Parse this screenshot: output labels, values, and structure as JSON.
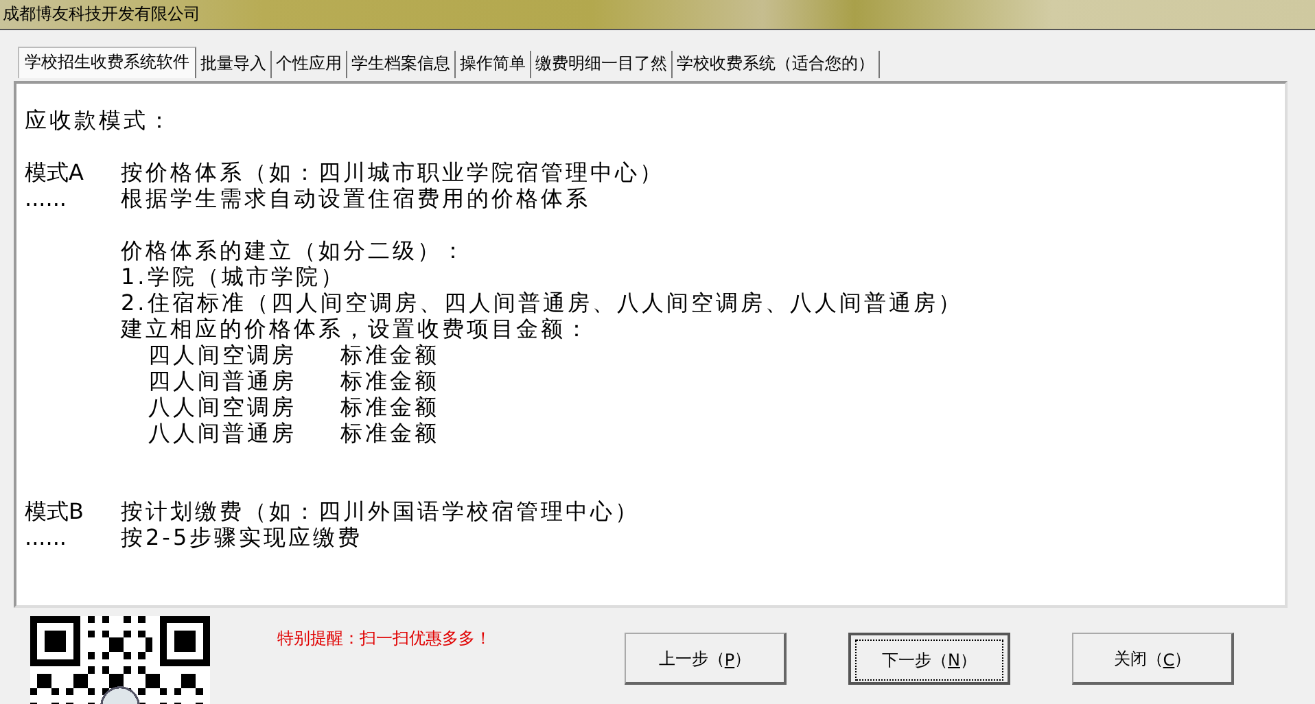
{
  "window": {
    "title": "成都博友科技开发有限公司"
  },
  "tabs": [
    {
      "label": "学校招生收费系统软件",
      "selected": true
    },
    {
      "label": "批量导入",
      "selected": false
    },
    {
      "label": "个性应用",
      "selected": false
    },
    {
      "label": "学生档案信息",
      "selected": false
    },
    {
      "label": "操作简单",
      "selected": false
    },
    {
      "label": "缴费明细一目了然",
      "selected": false
    },
    {
      "label": "学校收费系统（适合您的）",
      "selected": false
    }
  ],
  "content": {
    "sections": [
      {
        "lines": [
          {
            "kind": "plain",
            "text": "应收款模式："
          }
        ]
      },
      {
        "lines": [
          {
            "kind": "mode",
            "prefix": "模式A",
            "text": "按价格体系（如：四川城市职业学院宿管理中心）"
          },
          {
            "kind": "mode",
            "prefix": "......",
            "text": "根据学生需求自动设置住宿费用的价格体系"
          }
        ]
      },
      {
        "lines": [
          {
            "kind": "detail",
            "text": "价格体系的建立（如分二级）："
          },
          {
            "kind": "detail",
            "text": "1.学院（城市学院）"
          },
          {
            "kind": "detail",
            "text": "2.住宿标准（四人间空调房、四人间普通房、八人间空调房、八人间普通房）"
          },
          {
            "kind": "detail",
            "text": "建立相应的价格体系，设置收费项目金额："
          },
          {
            "kind": "pair",
            "text": "四人间空调房",
            "value": "标准金额"
          },
          {
            "kind": "pair",
            "text": "四人间普通房",
            "value": "标准金额"
          },
          {
            "kind": "pair",
            "text": "八人间空调房",
            "value": "标准金额"
          },
          {
            "kind": "pair",
            "text": "八人间普通房",
            "value": "标准金额"
          }
        ]
      },
      {
        "lines": [
          {
            "kind": "mode",
            "prefix": "模式B",
            "text": "按计划缴费（如：四川外国语学校宿管理中心）"
          },
          {
            "kind": "mode",
            "prefix": "......",
            "text": "按2-5步骤实现应缴费"
          }
        ]
      }
    ]
  },
  "notice": "特别提醒：扫一扫优惠多多！",
  "buttons": [
    {
      "before": "上一步（",
      "key": "P",
      "after": "）",
      "focused": false
    },
    {
      "before": "下一步（",
      "key": "N",
      "after": "）",
      "focused": true
    },
    {
      "before": "关闭（",
      "key": "C",
      "after": "）",
      "focused": false
    }
  ]
}
